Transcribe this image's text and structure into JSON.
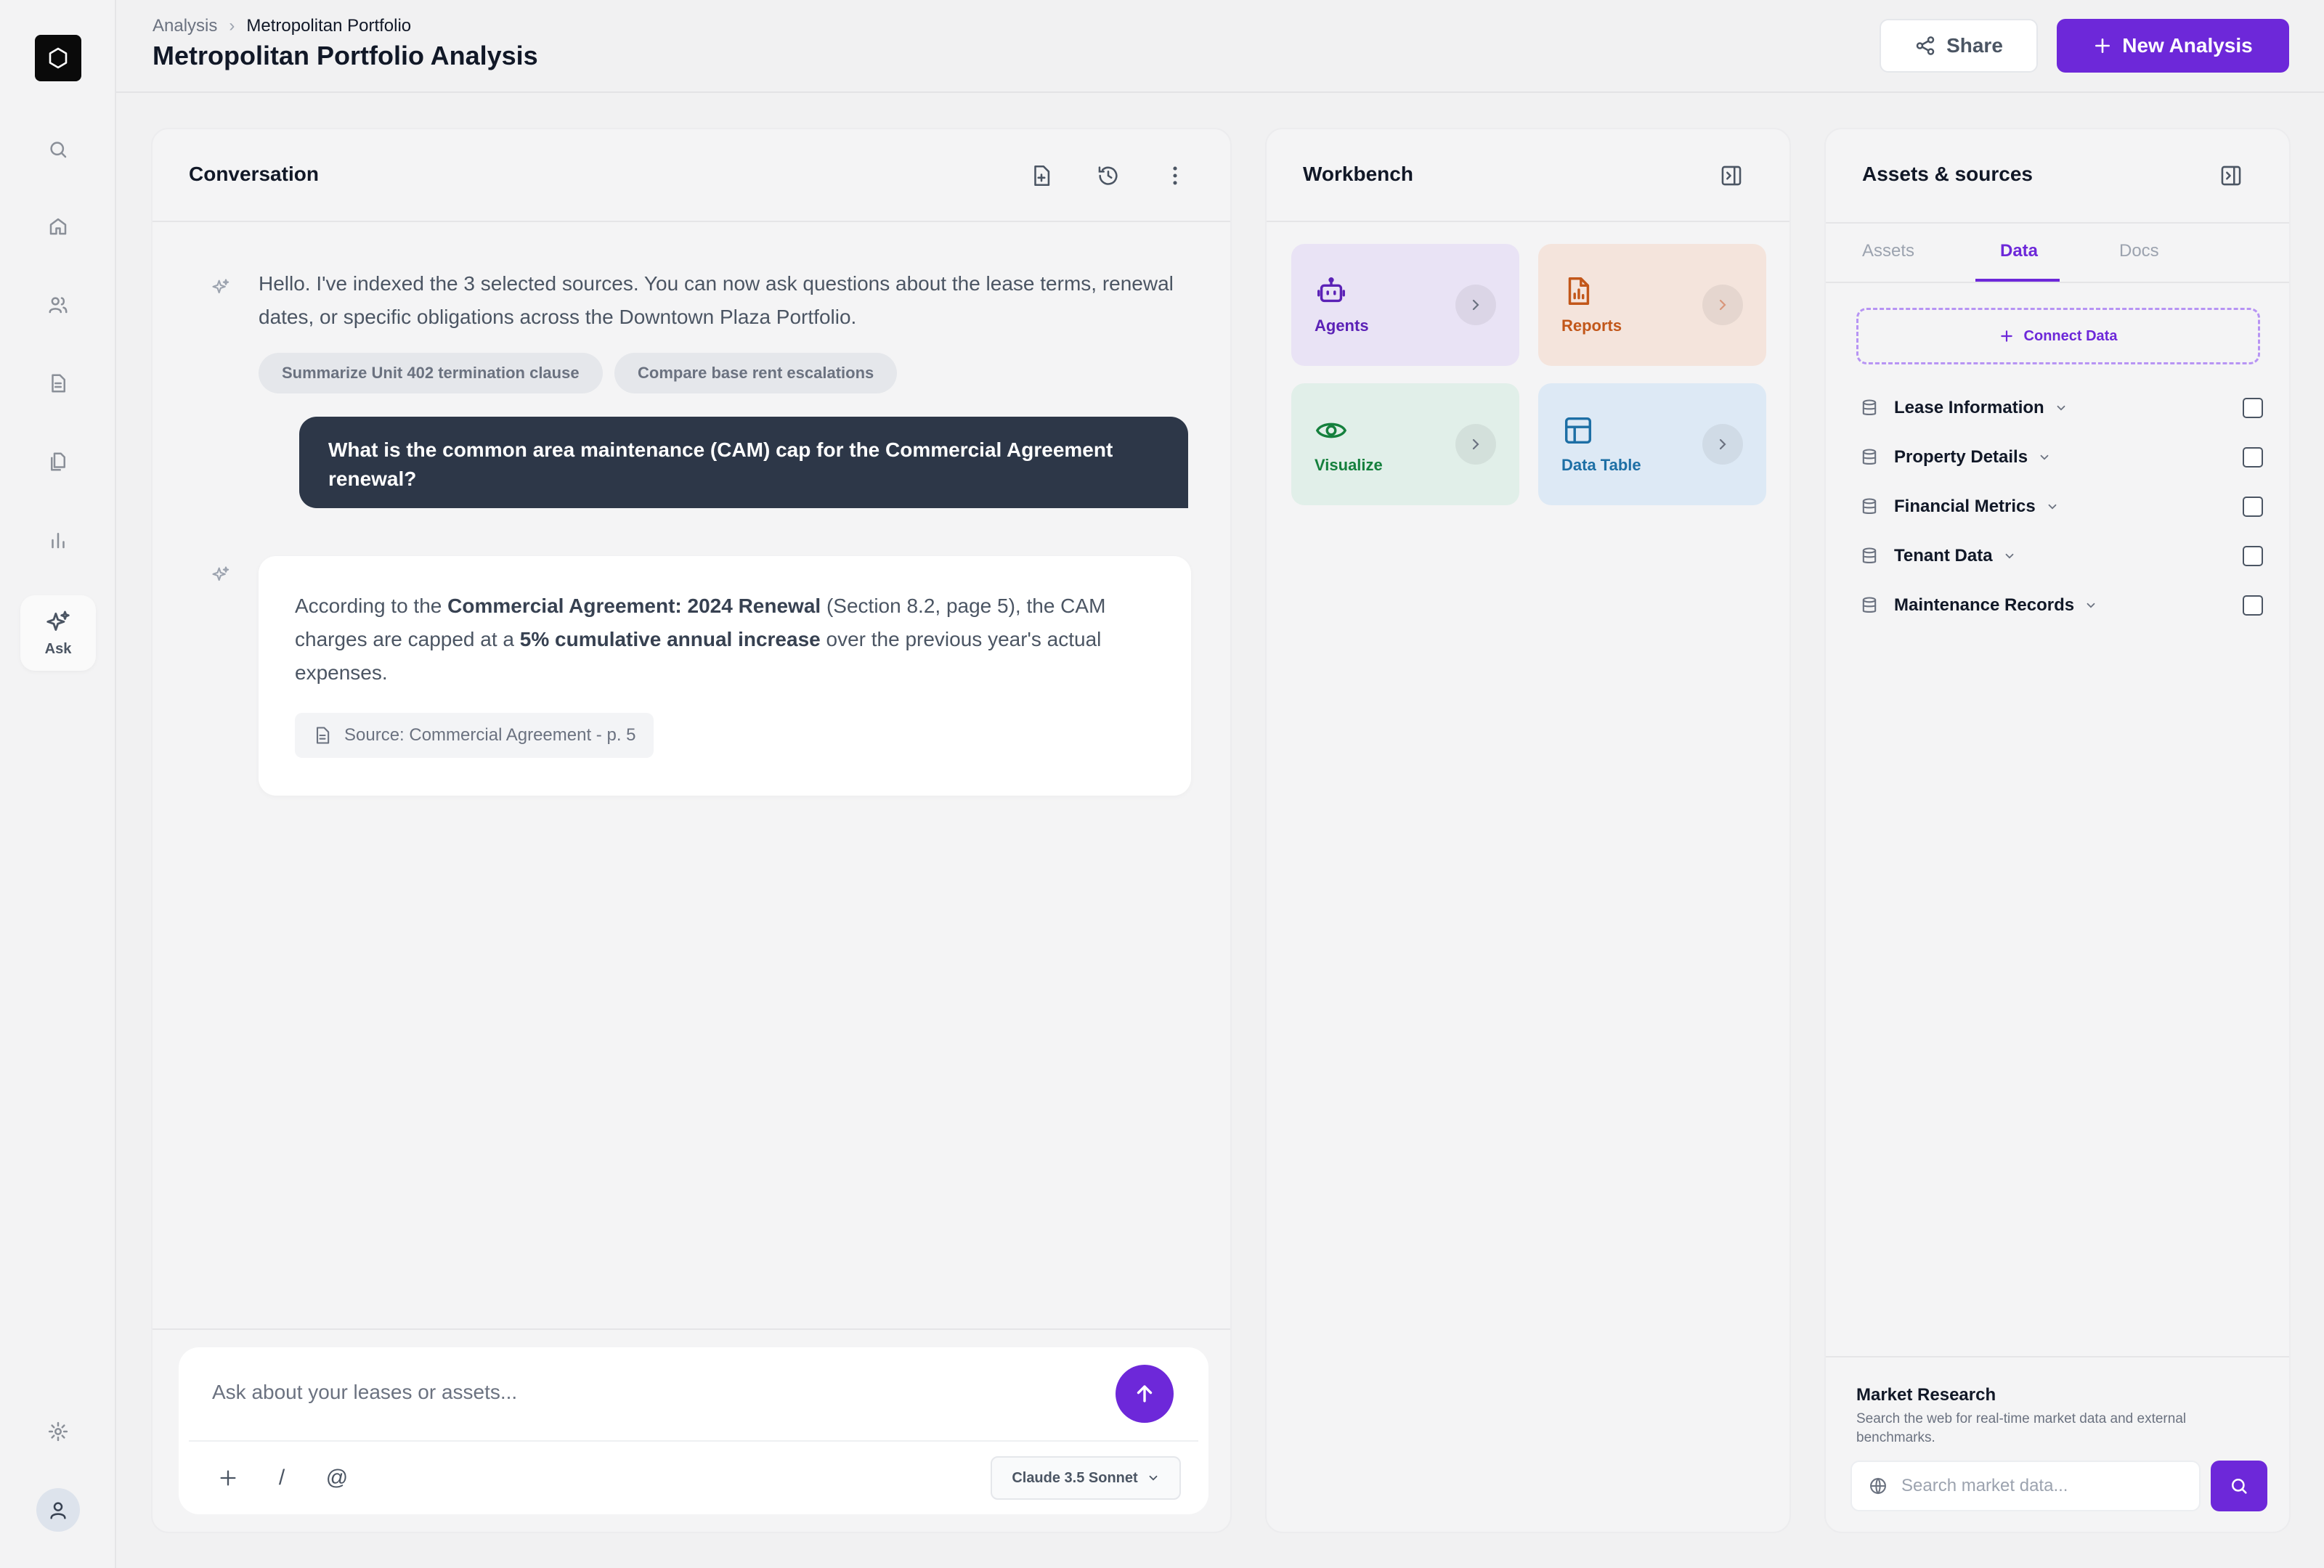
{
  "header": {
    "breadcrumb": [
      "Analysis",
      "Metropolitan Portfolio"
    ],
    "title": "Metropolitan Portfolio Analysis",
    "share_label": "Share",
    "new_label": "New Analysis"
  },
  "sidebar": {
    "items": [
      "search-icon",
      "home-icon",
      "users-icon",
      "document-icon",
      "files-icon",
      "chart-icon"
    ],
    "ask_label": "Ask"
  },
  "conversation": {
    "title": "Conversation",
    "ai_greeting": "Hello. I've indexed the 3 selected sources. You can now ask questions about the lease terms, renewal dates, or specific obligations across the Downtown Plaza Portfolio.",
    "suggestions": [
      "Summarize Unit 402 termination clause",
      "Compare base rent escalations"
    ],
    "user_message": "What is the common area maintenance (CAM) cap for the Commercial Agreement renewal?",
    "answer": {
      "part1": "According to the ",
      "bold1": "Commercial Agreement: 2024 Renewal",
      "part2": " (Section 8.2, page 5), the CAM charges are capped at a ",
      "bold2": "5% cumulative annual increase",
      "part3": " over the previous year's actual expenses.",
      "source": "Source: Commercial Agreement - p. 5"
    },
    "composer": {
      "placeholder": "Ask about your leases or assets...",
      "slash": "/",
      "at": "@",
      "model": "Claude 3.5 Sonnet"
    }
  },
  "workbench": {
    "title": "Workbench",
    "tiles": [
      {
        "label": "Agents",
        "color": "#5b21b6",
        "bg": "#e9e3f5"
      },
      {
        "label": "Reports",
        "color": "#c2571a",
        "bg": "#f4e4dc"
      },
      {
        "label": "Visualize",
        "color": "#15803d",
        "bg": "#e1efe9"
      },
      {
        "label": "Data Table",
        "color": "#1d6fa5",
        "bg": "#dde9f5"
      }
    ]
  },
  "assets": {
    "title": "Assets & sources",
    "tabs": [
      "Assets",
      "Data",
      "Docs"
    ],
    "active_tab": "Data",
    "connect_label": "Connect Data",
    "sources": [
      "Lease Information",
      "Property Details",
      "Financial Metrics",
      "Tenant Data",
      "Maintenance Records"
    ],
    "market": {
      "title": "Market Research",
      "description": "Search the web for real-time market data and external benchmarks.",
      "placeholder": "Search market data..."
    }
  },
  "colors": {
    "accent": "#6d28d9",
    "user_bubble": "#2d3748"
  }
}
